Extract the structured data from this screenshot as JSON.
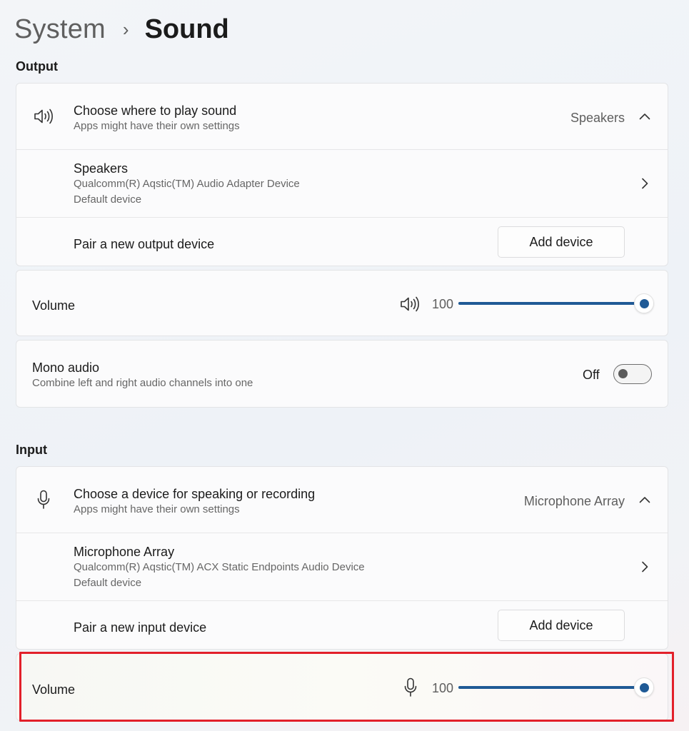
{
  "breadcrumb": {
    "parent": "System",
    "separator": "›",
    "current": "Sound"
  },
  "output": {
    "section_title": "Output",
    "choose": {
      "title": "Choose where to play sound",
      "subtitle": "Apps might have their own settings",
      "selected": "Speakers"
    },
    "device": {
      "name": "Speakers",
      "detail": "Qualcomm(R) Aqstic(TM) Audio Adapter Device",
      "status": "Default device"
    },
    "pair": {
      "label": "Pair a new output device",
      "button": "Add device"
    },
    "volume": {
      "label": "Volume",
      "value": "100",
      "level": 1.0
    },
    "mono": {
      "title": "Mono audio",
      "subtitle": "Combine left and right audio channels into one",
      "state": "Off"
    }
  },
  "input": {
    "section_title": "Input",
    "choose": {
      "title": "Choose a device for speaking or recording",
      "subtitle": "Apps might have their own settings",
      "selected": "Microphone Array"
    },
    "device": {
      "name": "Microphone Array",
      "detail": "Qualcomm(R) Aqstic(TM) ACX Static Endpoints Audio Device",
      "status": "Default device"
    },
    "pair": {
      "label": "Pair a new input device",
      "button": "Add device"
    },
    "volume": {
      "label": "Volume",
      "value": "100",
      "level": 1.0
    }
  },
  "colors": {
    "accent": "#1f5a96",
    "highlight": "#e2202a"
  },
  "icons": [
    "speaker-icon",
    "chevron-up-icon",
    "chevron-right-icon",
    "microphone-icon"
  ]
}
